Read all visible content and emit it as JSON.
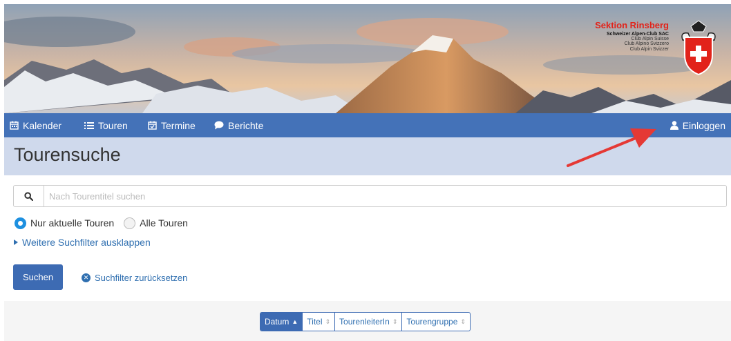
{
  "brand": {
    "title": "Sektion Rinsberg",
    "subtitle": "Schweizer Alpen-Club SAC",
    "lines": [
      "Club Alpin Suisse",
      "Club Alpino Svizzero",
      "Club Alpin Svizzer"
    ]
  },
  "nav": {
    "kalender": "Kalender",
    "touren": "Touren",
    "termine": "Termine",
    "berichte": "Berichte",
    "login": "Einloggen"
  },
  "page": {
    "title": "Tourensuche"
  },
  "search": {
    "placeholder": "Nach Tourentitel suchen",
    "value": ""
  },
  "filters": {
    "radio_current": "Nur aktuelle Touren",
    "radio_all": "Alle Touren",
    "more": "Weitere Suchfilter ausklappen"
  },
  "actions": {
    "search": "Suchen",
    "reset": "Suchfilter zurücksetzen"
  },
  "sort": {
    "datum": "Datum",
    "titel": "Titel",
    "leiter": "TourenleiterIn",
    "gruppe": "Tourengruppe"
  },
  "colors": {
    "nav": "#4472b8",
    "header": "#cfd9ec",
    "accent": "#e2231a",
    "link": "#2f6fb0"
  }
}
